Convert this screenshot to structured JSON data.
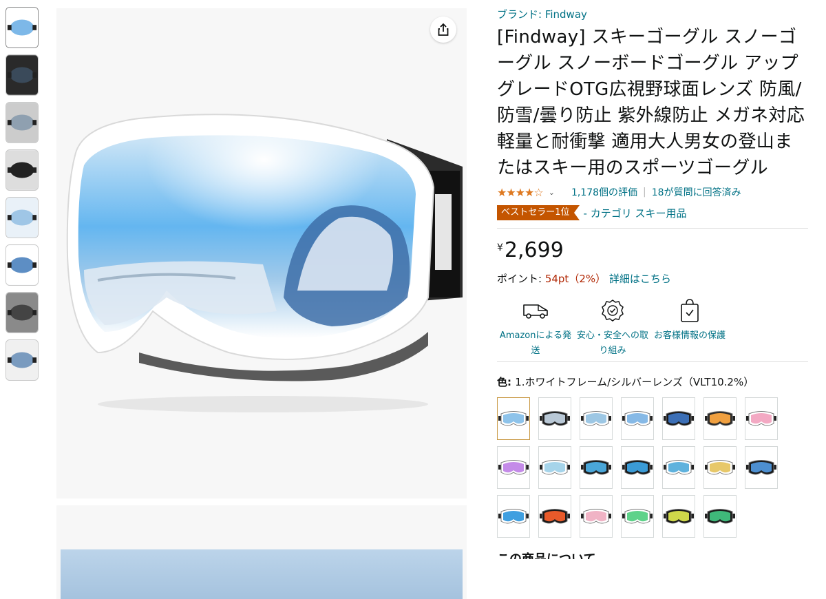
{
  "thumbnails": [
    {
      "name": "thumb-goggle-white",
      "lens": "#7db8e8",
      "frame": "#ffffff"
    },
    {
      "name": "thumb-skier",
      "lens": "#3a4a5a",
      "frame": "#2a2a2a"
    },
    {
      "name": "thumb-skier-portrait",
      "lens": "#8fa0b0",
      "frame": "#cccccc"
    },
    {
      "name": "thumb-strap",
      "lens": "#222222",
      "frame": "#dddddd"
    },
    {
      "name": "thumb-lens-diagram",
      "lens": "#9fc6e6",
      "frame": "#e9f1f8"
    },
    {
      "name": "thumb-otg",
      "lens": "#5d8ec4",
      "frame": "#ffffff"
    },
    {
      "name": "thumb-video",
      "lens": "#444444",
      "frame": "#8a8a8a"
    },
    {
      "name": "thumb-colors",
      "lens": "#7a9bbf",
      "frame": "#f0f0f0"
    }
  ],
  "share_icon": "share-icon",
  "product": {
    "brand": "ブランド: Findway",
    "title": "[Findway] スキーゴーグル スノーゴーグル スノーボードゴーグル アップグレードOTG広視野球面レンズ 防風/防雪/曇り防止 紫外線防止 メガネ対応 軽量と耐衝撃 適用大人男女の登山またはスキー用のスポーツゴーグル",
    "stars": "★★★★☆",
    "rating_value": 4.0,
    "ratings_count": "1,178個の評価",
    "answered": "18が質問に回答済み",
    "bestseller_badge": "ベストセラー1位",
    "category": "- カテゴリ スキー用品",
    "currency": "¥",
    "price": "2,699",
    "points_label": "ポイント: ",
    "points_value": "54pt（2%）",
    "points_link": "詳細はこちら"
  },
  "features": [
    {
      "icon": "delivery-van-icon",
      "label": "Amazonによる発送"
    },
    {
      "icon": "safety-badge-icon",
      "label": "安心・安全への取り組み"
    },
    {
      "icon": "secure-bag-icon",
      "label": "お客様情報の保護"
    }
  ],
  "color": {
    "label": "色: ",
    "value": "1.ホワイトフレーム/シルバーレンズ（VLT10.2%）"
  },
  "swatches": [
    {
      "frame": "#ffffff",
      "lens": "#8ec3ea",
      "selected": true
    },
    {
      "frame": "#1f1f1f",
      "lens": "#b9c8d6"
    },
    {
      "frame": "#ffffff",
      "lens": "#9dc7e4"
    },
    {
      "frame": "#ffffff",
      "lens": "#86b9e6"
    },
    {
      "frame": "#1a1a1a",
      "lens": "#3c6fb6"
    },
    {
      "frame": "#2a2a2a",
      "lens": "#f0a040"
    },
    {
      "frame": "#ffffff",
      "lens": "#f3a9c3"
    },
    {
      "frame": "#ffffff",
      "lens": "#c48be8"
    },
    {
      "frame": "#ffffff",
      "lens": "#a6d4ea"
    },
    {
      "frame": "#1a1a1a",
      "lens": "#4aa6d8"
    },
    {
      "frame": "#1a1a1a",
      "lens": "#3b9bd6"
    },
    {
      "frame": "#ffffff",
      "lens": "#5fb2dd"
    },
    {
      "frame": "#ffffff",
      "lens": "#e7c86a"
    },
    {
      "frame": "#1a1a1a",
      "lens": "#4d8fd0"
    },
    {
      "frame": "#ffffff",
      "lens": "#3f9fe0"
    },
    {
      "frame": "#1a1a1a",
      "lens": "#e85a2a"
    },
    {
      "frame": "#ffffff",
      "lens": "#f0b3c5"
    },
    {
      "frame": "#ffffff",
      "lens": "#5fd28a"
    },
    {
      "frame": "#1a1a1a",
      "lens": "#cfd84a"
    },
    {
      "frame": "#1a1a1a",
      "lens": "#3fb87a"
    }
  ],
  "about_heading": "この商品について"
}
